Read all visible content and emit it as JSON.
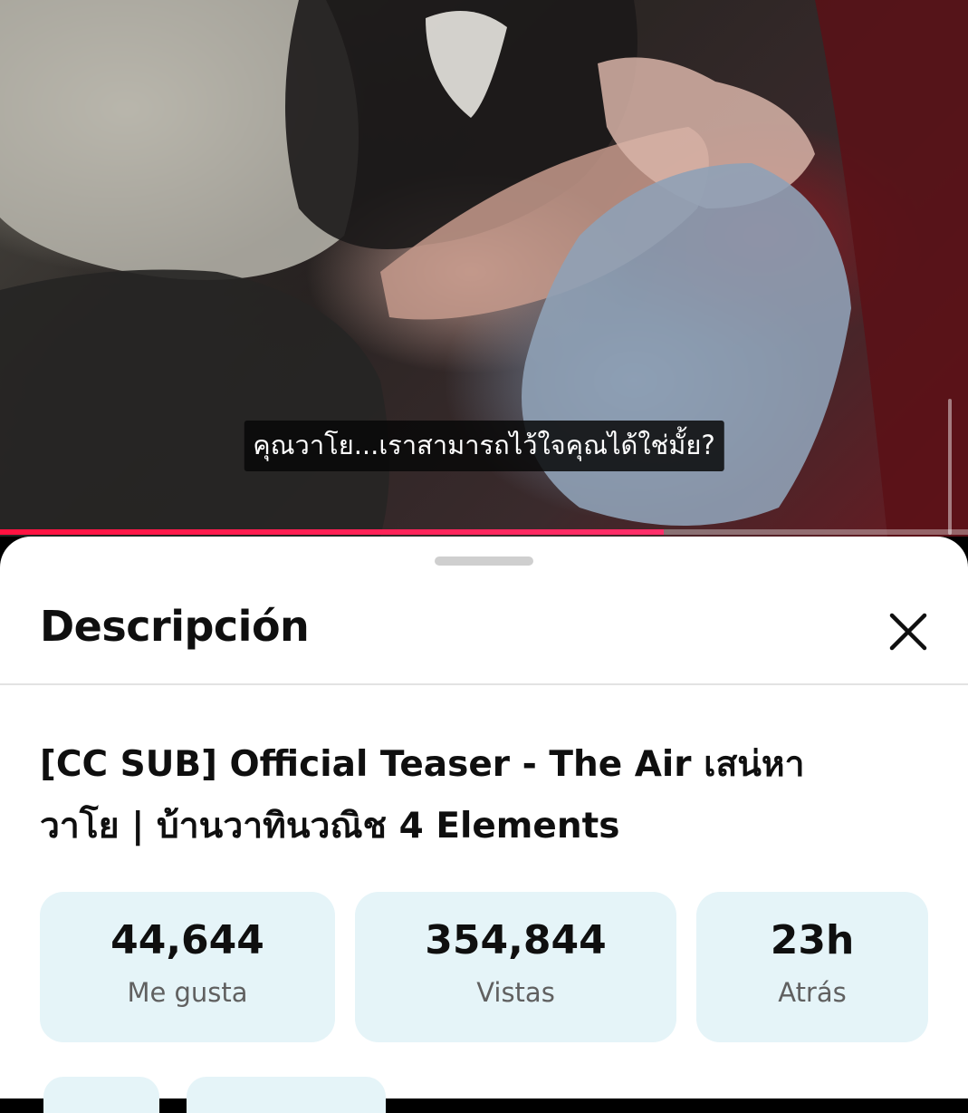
{
  "player": {
    "subtitle": "คุณวาโย...เราสามารถไว้ใจคุณได้ใช่มั้ย?",
    "progress_fraction": 0.686,
    "accent_color": "#ff1240"
  },
  "description_panel": {
    "heading": "Descripción",
    "close_icon": "close-icon",
    "video_title_line1": "[CC SUB] Official Teaser - The Air เสน่หา",
    "video_title_line2": "วาโย | บ้านวาทินวณิช 4 Elements",
    "stats": [
      {
        "value": "44,644",
        "label": "Me gusta"
      },
      {
        "value": "354,844",
        "label": "Vistas"
      },
      {
        "value": "23h",
        "label": "Atrás"
      }
    ]
  }
}
